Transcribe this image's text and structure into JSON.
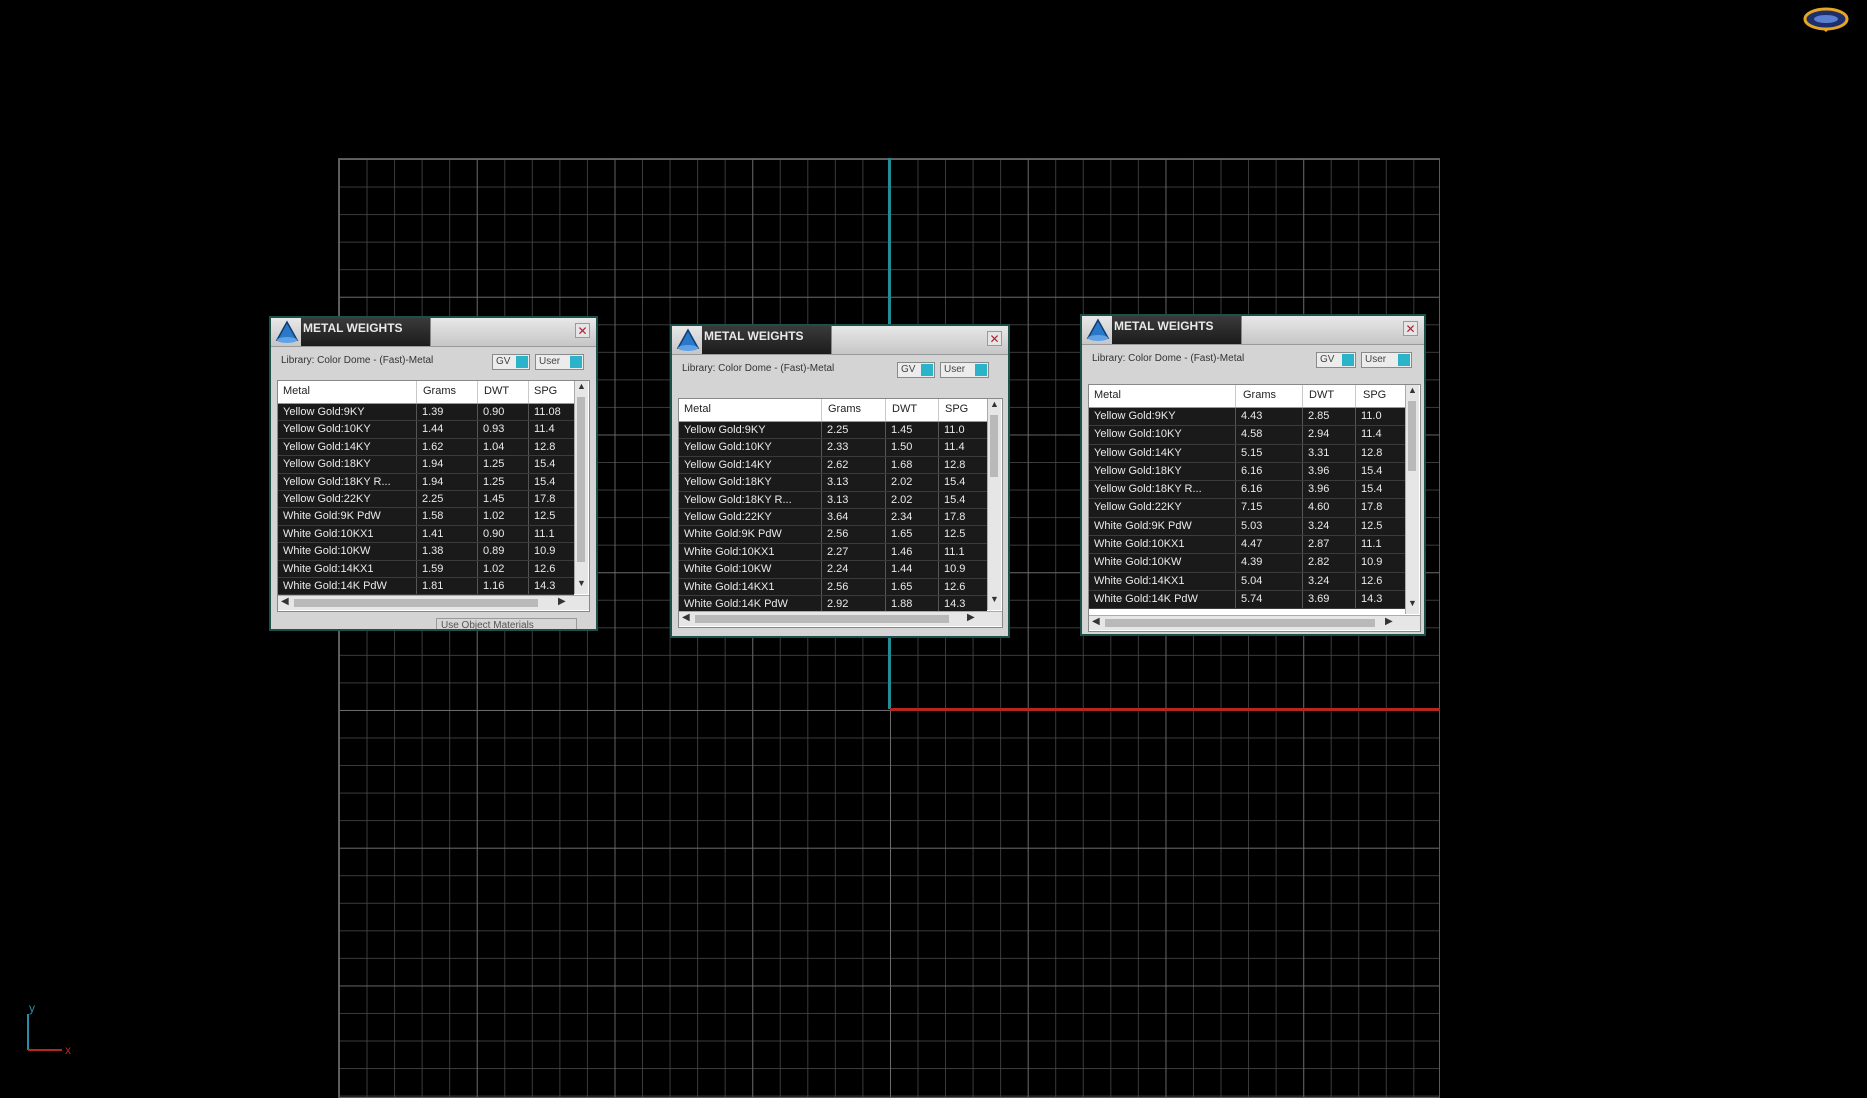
{
  "panels": [
    {
      "title": "METAL WEIGHTS",
      "library": "Library: Color Dome - (Fast)-Metal",
      "gv_label": "GV",
      "user_label": "User",
      "columns": [
        "Metal",
        "Grams",
        "DWT",
        "SPG"
      ],
      "footer": "Use Object Materials",
      "rows": [
        [
          "Yellow Gold:9KY",
          "1.39",
          "0.90",
          "11.08"
        ],
        [
          "Yellow Gold:10KY",
          "1.44",
          "0.93",
          "11.4"
        ],
        [
          "Yellow Gold:14KY",
          "1.62",
          "1.04",
          "12.8"
        ],
        [
          "Yellow Gold:18KY",
          "1.94",
          "1.25",
          "15.4"
        ],
        [
          "Yellow Gold:18KY R...",
          "1.94",
          "1.25",
          "15.4"
        ],
        [
          "Yellow Gold:22KY",
          "2.25",
          "1.45",
          "17.8"
        ],
        [
          "White Gold:9K PdW",
          "1.58",
          "1.02",
          "12.5"
        ],
        [
          "White Gold:10KX1",
          "1.41",
          "0.90",
          "11.1"
        ],
        [
          "White Gold:10KW",
          "1.38",
          "0.89",
          "10.9"
        ],
        [
          "White Gold:14KX1",
          "1.59",
          "1.02",
          "12.6"
        ],
        [
          "White Gold:14K PdW",
          "1.81",
          "1.16",
          "14.3"
        ]
      ]
    },
    {
      "title": "METAL WEIGHTS",
      "library": "Library: Color Dome - (Fast)-Metal",
      "gv_label": "GV",
      "user_label": "User",
      "columns": [
        "Metal",
        "Grams",
        "DWT",
        "SPG"
      ],
      "rows": [
        [
          "Yellow Gold:9KY",
          "2.25",
          "1.45",
          "11.0"
        ],
        [
          "Yellow Gold:10KY",
          "2.33",
          "1.50",
          "11.4"
        ],
        [
          "Yellow Gold:14KY",
          "2.62",
          "1.68",
          "12.8"
        ],
        [
          "Yellow Gold:18KY",
          "3.13",
          "2.02",
          "15.4"
        ],
        [
          "Yellow Gold:18KY R...",
          "3.13",
          "2.02",
          "15.4"
        ],
        [
          "Yellow Gold:22KY",
          "3.64",
          "2.34",
          "17.8"
        ],
        [
          "White Gold:9K PdW",
          "2.56",
          "1.65",
          "12.5"
        ],
        [
          "White Gold:10KX1",
          "2.27",
          "1.46",
          "11.1"
        ],
        [
          "White Gold:10KW",
          "2.24",
          "1.44",
          "10.9"
        ],
        [
          "White Gold:14KX1",
          "2.56",
          "1.65",
          "12.6"
        ],
        [
          "White Gold:14K PdW",
          "2.92",
          "1.88",
          "14.3"
        ]
      ]
    },
    {
      "title": "METAL WEIGHTS",
      "library": "Library: Color Dome - (Fast)-Metal",
      "gv_label": "GV",
      "user_label": "User",
      "columns": [
        "Metal",
        "Grams",
        "DWT",
        "SPG"
      ],
      "rows": [
        [
          "Yellow Gold:9KY",
          "4.43",
          "2.85",
          "11.0"
        ],
        [
          "Yellow Gold:10KY",
          "4.58",
          "2.94",
          "11.4"
        ],
        [
          "Yellow Gold:14KY",
          "5.15",
          "3.31",
          "12.8"
        ],
        [
          "Yellow Gold:18KY",
          "6.16",
          "3.96",
          "15.4"
        ],
        [
          "Yellow Gold:18KY R...",
          "6.16",
          "3.96",
          "15.4"
        ],
        [
          "Yellow Gold:22KY",
          "7.15",
          "4.60",
          "17.8"
        ],
        [
          "White Gold:9K PdW",
          "5.03",
          "3.24",
          "12.5"
        ],
        [
          "White Gold:10KX1",
          "4.47",
          "2.87",
          "11.1"
        ],
        [
          "White Gold:10KW",
          "4.39",
          "2.82",
          "10.9"
        ],
        [
          "White Gold:14KX1",
          "5.04",
          "3.24",
          "12.6"
        ],
        [
          "White Gold:14K PdW",
          "5.74",
          "3.69",
          "14.3"
        ]
      ]
    }
  ],
  "triad": {
    "y_label": "y",
    "x_label": "x"
  },
  "colors": {
    "axis_y": "#1f8c96",
    "axis_x": "#b3271f",
    "toggle_accent": "#2bb3c9"
  },
  "icons": {
    "top_right_logo": "logo-badge-icon",
    "panel_icon": "metal-cone-icon",
    "close": "close-icon"
  }
}
